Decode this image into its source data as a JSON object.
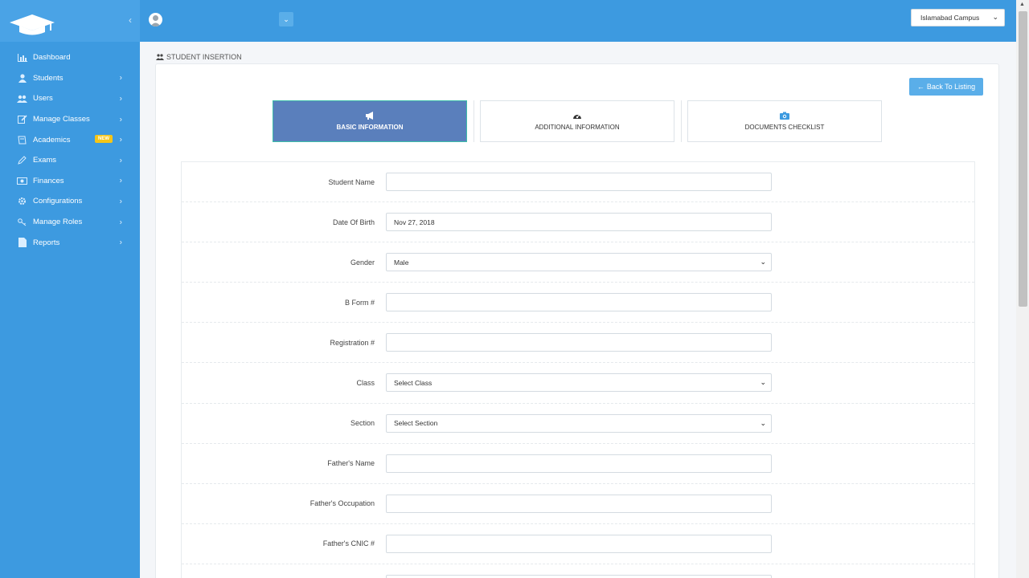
{
  "sidebar": {
    "items": [
      {
        "label": "Dashboard",
        "icon": "bar-chart-icon",
        "has_children": false
      },
      {
        "label": "Students",
        "icon": "user-icon",
        "has_children": true
      },
      {
        "label": "Users",
        "icon": "users-icon",
        "has_children": true
      },
      {
        "label": "Manage Classes",
        "icon": "edit-icon",
        "has_children": true
      },
      {
        "label": "Academics",
        "icon": "book-icon",
        "has_children": true,
        "badge": "NEW"
      },
      {
        "label": "Exams",
        "icon": "pencil-icon",
        "has_children": true
      },
      {
        "label": "Finances",
        "icon": "money-icon",
        "has_children": true
      },
      {
        "label": "Configurations",
        "icon": "gear-icon",
        "has_children": true
      },
      {
        "label": "Manage Roles",
        "icon": "key-icon",
        "has_children": true
      },
      {
        "label": "Reports",
        "icon": "file-icon",
        "has_children": true
      }
    ]
  },
  "topbar": {
    "campus": "Islamabad Campus"
  },
  "page": {
    "title": "STUDENT INSERTION",
    "back_label": "Back To Listing"
  },
  "steps": [
    {
      "label": "BASIC INFORMATION",
      "icon": "bullhorn-icon",
      "active": true
    },
    {
      "label": "ADDITIONAL INFORMATION",
      "icon": "dashboard-icon",
      "active": false
    },
    {
      "label": "DOCUMENTS CHECKLIST",
      "icon": "camera-icon",
      "active": false
    }
  ],
  "form": {
    "fields": [
      {
        "label": "Student Name",
        "type": "text",
        "value": ""
      },
      {
        "label": "Date Of Birth",
        "type": "text",
        "value": "Nov 27, 2018"
      },
      {
        "label": "Gender",
        "type": "select",
        "value": "Male"
      },
      {
        "label": "B Form #",
        "type": "text",
        "value": ""
      },
      {
        "label": "Registration #",
        "type": "text",
        "value": ""
      },
      {
        "label": "Class",
        "type": "select",
        "value": "Select Class"
      },
      {
        "label": "Section",
        "type": "select",
        "value": "Select Section"
      },
      {
        "label": "Father's Name",
        "type": "text",
        "value": ""
      },
      {
        "label": "Father's Occupation",
        "type": "text",
        "value": ""
      },
      {
        "label": "Father's CNIC #",
        "type": "text",
        "value": ""
      },
      {
        "label": "",
        "type": "text",
        "value": ""
      }
    ]
  },
  "colors": {
    "brand": "#3d9ae0",
    "active_step": "#5a7fbc",
    "badge": "#f5c518"
  }
}
